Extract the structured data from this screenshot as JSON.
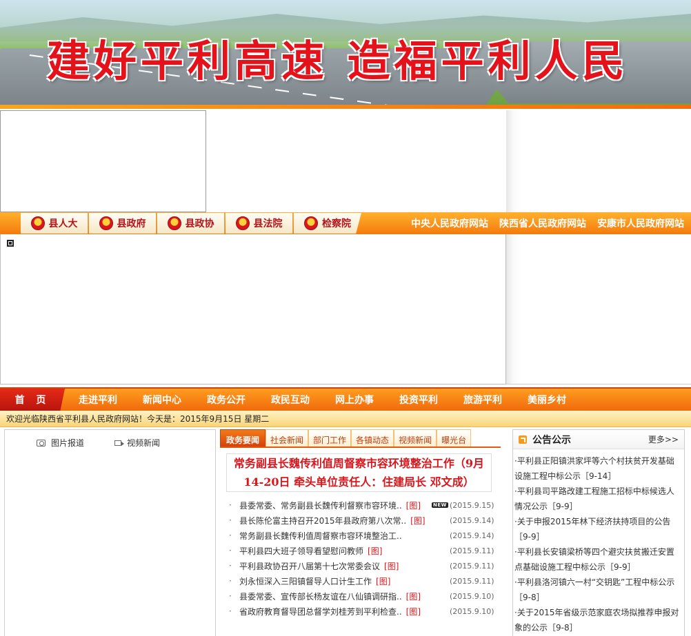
{
  "banner": {
    "slogan": "建好平利高速 造福平利人民"
  },
  "linkbar": {
    "tabs": [
      {
        "label": "县人大"
      },
      {
        "label": "县政府"
      },
      {
        "label": "县政协"
      },
      {
        "label": "县法院"
      },
      {
        "label": "检察院"
      }
    ],
    "external": [
      {
        "label": "中央人民政府网站"
      },
      {
        "label": "陕西省人民政府网站"
      },
      {
        "label": "安康市人民政府网站"
      }
    ]
  },
  "nav": {
    "home": "首 页",
    "items": [
      "走进平利",
      "新闻中心",
      "政务公开",
      "政民互动",
      "网上办事",
      "投资平利",
      "旅游平利",
      "美丽乡村"
    ]
  },
  "welcome": {
    "text": "欢迎光临陕西省平利县人民政府网站！今天是：2015年9月15日 星期二"
  },
  "media": {
    "photo_label": "图片报道",
    "video_label": "视频新闻"
  },
  "news": {
    "tabs": [
      "政务要闻",
      "社会新闻",
      "部门工作",
      "各镇动态",
      "视频新闻",
      "曝光台"
    ],
    "headline": "常务副县长魏传利值周督察市容环境整治工作（9月14-20日 牵头单位责任人：住建局长 邓文成）",
    "new_badge": "NEW",
    "items": [
      {
        "title": "县委常委、常务副县长魏传利督察市容环境..",
        "tag": "[图]",
        "date": "(2015.9.15)",
        "isnew": true
      },
      {
        "title": "县长陈伦富主持召开2015年县政府第八次常..",
        "tag": "[图]",
        "date": "(2015.9.14)"
      },
      {
        "title": "常务副县长魏传利值周督察市容环境整治工..",
        "tag": "",
        "date": "(2015.9.14)"
      },
      {
        "title": "平利县四大班子领导看望慰问教师",
        "tag": "[图]",
        "date": "(2015.9.11)"
      },
      {
        "title": "平利县政协召开八届第十七次常委会议",
        "tag": "[图]",
        "date": "(2015.9.11)"
      },
      {
        "title": "刘永恒深入三阳镇督导人口计生工作",
        "tag": "[图]",
        "date": "(2015.9.11)"
      },
      {
        "title": "县委常委、宣传部长杨友谊在八仙镇调研指..",
        "tag": "[图]",
        "date": "(2015.9.10)"
      },
      {
        "title": "省政府教育督导团总督学刘桂芳到平利检查..",
        "tag": "[图]",
        "date": "(2015.9.10)"
      }
    ]
  },
  "notice": {
    "title": "公告公示",
    "more": "更多>>",
    "items": [
      "·平利县正阳镇洪家坪等六个村扶贫开发基础设施工程中标公示［9-14］",
      "·平利县司平路改建工程施工招标中标候选人情况公示［9-9］",
      "·关于申报2015年林下经济扶持项目的公告［9-9］",
      "·平利县长安镇梁桥等四个避灾扶贫搬迁安置点基础设施工程中标公示［9-9］",
      "·平利县洛河镇六一村“交钥匙”工程中标公示［9-8］",
      "·关于2015年省级示范家庭农场拟推荐申报对象的公示［9-8］"
    ]
  }
}
